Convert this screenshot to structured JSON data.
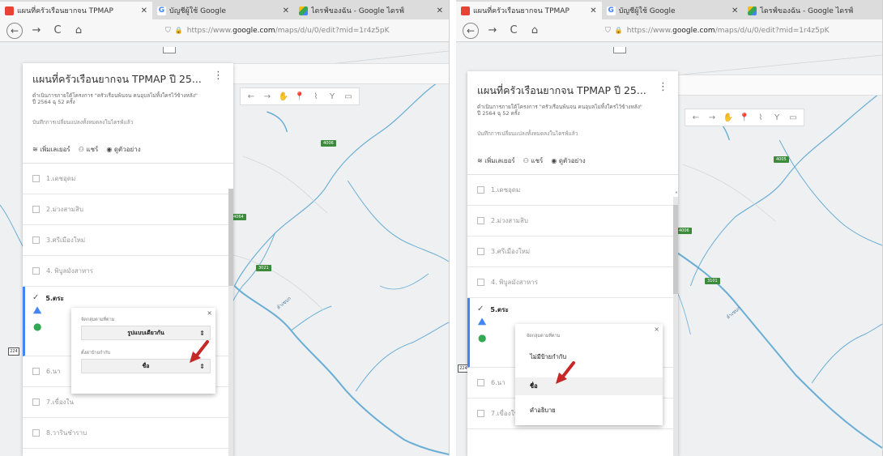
{
  "browser": {
    "tabs": [
      {
        "label": "แผนที่ครัวเรือนยากจน TPMAP",
        "close": "✕"
      },
      {
        "label": "บัญชีผู้ใช้ Google",
        "close": "✕"
      },
      {
        "label": "ไดรฟ์ของฉัน - Google ไดรฟ์",
        "close": "✕"
      }
    ],
    "url_prefix": "https://www.",
    "url_host": "google.com",
    "url_path": "/maps/d/u/0/edit?mid=1r4z5pK"
  },
  "panel": {
    "title": "แผนที่ครัวเรือนยากจน TPMAP ปี 25...",
    "description": "ดำเนินการภายใต้โครงการ \"ครัวเรือนพ้นจน คนอุบลไม่ทิ้งใครไว้ข้างหลัง\" ปี 2564 ฉุ 52 ครั้ง",
    "saved_status": "บันทึกการเปลี่ยนแปลงทั้งหมดลงในไดรฟ์แล้ว",
    "actions": {
      "add_layer": "เพิ่มเลเยอร์",
      "share": "แชร์",
      "preview": "ดูตัวอย่าง"
    },
    "layers": [
      "1.เดชอุดม",
      "2.ม่วงสามสิบ",
      "3.ศรีเมืองใหม่",
      "4. พิบูลมังสาหาร",
      "5.ตระ",
      "6.นา",
      "7.เขื่องใน",
      "8.วารินชำราบ"
    ]
  },
  "left_popup": {
    "group_label": "จัดกลุ่มตามที่ตาม",
    "group_value": "รูปแบบเดียวกัน",
    "labels_label": "ตั้งค่าป้ายกำกับ",
    "labels_value": "ชื่อ"
  },
  "right_popup": {
    "group_label": "จัดกลุ่มตามที่ตาม",
    "options": [
      "ไม่มีป้ายกำกับ",
      "ชื่อ",
      "คำอธิบาย"
    ]
  },
  "map": {
    "road_labels": [
      "4006",
      "4064",
      "3021",
      "4005",
      "3101"
    ],
    "river_label": "ลำเซบก",
    "edge_badge": "224"
  },
  "icons": {
    "back": "←",
    "forward": "→",
    "reload": "C",
    "home": "⌂",
    "shield": "⛉",
    "lock": "🔒",
    "kebab": "⋮",
    "close": "×",
    "select_arrows": "⇕",
    "check": "✓",
    "up": "˄"
  },
  "colors": {
    "accent": "#4285f4",
    "river": "#6aaed6",
    "arrow": "#c62828",
    "road_label": "#3c8a3c"
  }
}
